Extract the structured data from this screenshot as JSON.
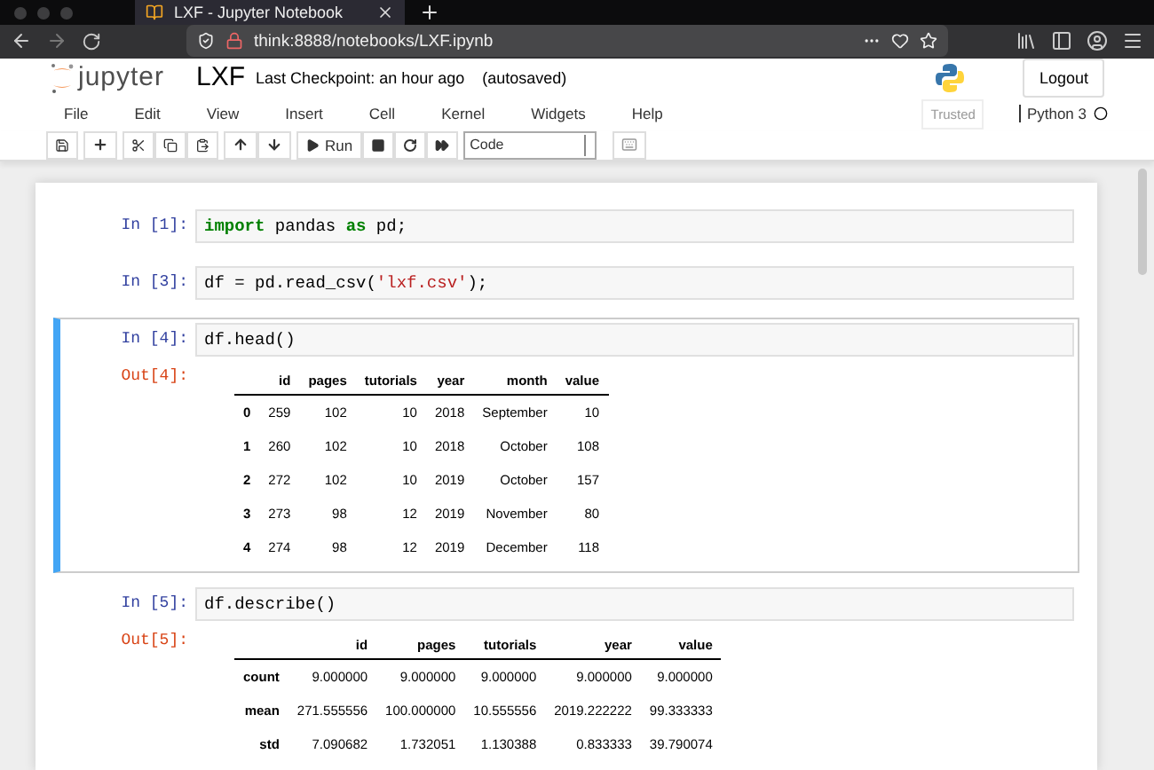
{
  "browser": {
    "tab_title": "LXF - Jupyter Notebook",
    "url": "think:8888/notebooks/LXF.ipynb"
  },
  "header": {
    "logo_text": "jupyter",
    "notebook_name": "LXF",
    "checkpoint": "Last Checkpoint: an hour ago",
    "autosave": "(autosaved)",
    "logout": "Logout"
  },
  "menu": [
    "File",
    "Edit",
    "View",
    "Insert",
    "Cell",
    "Kernel",
    "Widgets",
    "Help"
  ],
  "status": {
    "trusted": "Trusted",
    "kernel": "Python 3"
  },
  "toolbar": {
    "run_label": "Run",
    "cell_type": "Code"
  },
  "cells": [
    {
      "prompt": "In [1]:",
      "selected": false,
      "code": [
        {
          "kind": "keyword",
          "text": "import"
        },
        {
          "kind": "plain",
          "text": " pandas "
        },
        {
          "kind": "keyword",
          "text": "as"
        },
        {
          "kind": "plain",
          "text": " pd;"
        }
      ]
    },
    {
      "prompt": "In [3]:",
      "selected": false,
      "code": [
        {
          "kind": "plain",
          "text": "df = pd.read_csv("
        },
        {
          "kind": "string",
          "text": "'lxf.csv'"
        },
        {
          "kind": "plain",
          "text": ");"
        }
      ]
    },
    {
      "prompt": "In [4]:",
      "selected": true,
      "code": [
        {
          "kind": "plain",
          "text": "df.head()"
        }
      ],
      "output": {
        "prompt": "Out[4]:",
        "columns": [
          "id",
          "pages",
          "tutorials",
          "year",
          "month",
          "value"
        ],
        "rows": [
          {
            "index": "0",
            "values": [
              "259",
              "102",
              "10",
              "2018",
              "September",
              "10"
            ]
          },
          {
            "index": "1",
            "values": [
              "260",
              "102",
              "10",
              "2018",
              "October",
              "108"
            ]
          },
          {
            "index": "2",
            "values": [
              "272",
              "102",
              "10",
              "2019",
              "October",
              "157"
            ]
          },
          {
            "index": "3",
            "values": [
              "273",
              "98",
              "12",
              "2019",
              "November",
              "80"
            ]
          },
          {
            "index": "4",
            "values": [
              "274",
              "98",
              "12",
              "2019",
              "December",
              "118"
            ]
          }
        ]
      }
    },
    {
      "prompt": "In [5]:",
      "selected": false,
      "code": [
        {
          "kind": "plain",
          "text": "df.describe()"
        }
      ],
      "output": {
        "prompt": "Out[5]:",
        "columns": [
          "id",
          "pages",
          "tutorials",
          "year",
          "value"
        ],
        "rows": [
          {
            "index": "count",
            "values": [
              "9.000000",
              "9.000000",
              "9.000000",
              "9.000000",
              "9.000000"
            ]
          },
          {
            "index": "mean",
            "values": [
              "271.555556",
              "100.000000",
              "10.555556",
              "2019.222222",
              "99.333333"
            ]
          },
          {
            "index": "std",
            "values": [
              "7.090682",
              "1.732051",
              "1.130388",
              "0.833333",
              "39.790074"
            ]
          }
        ]
      }
    }
  ]
}
